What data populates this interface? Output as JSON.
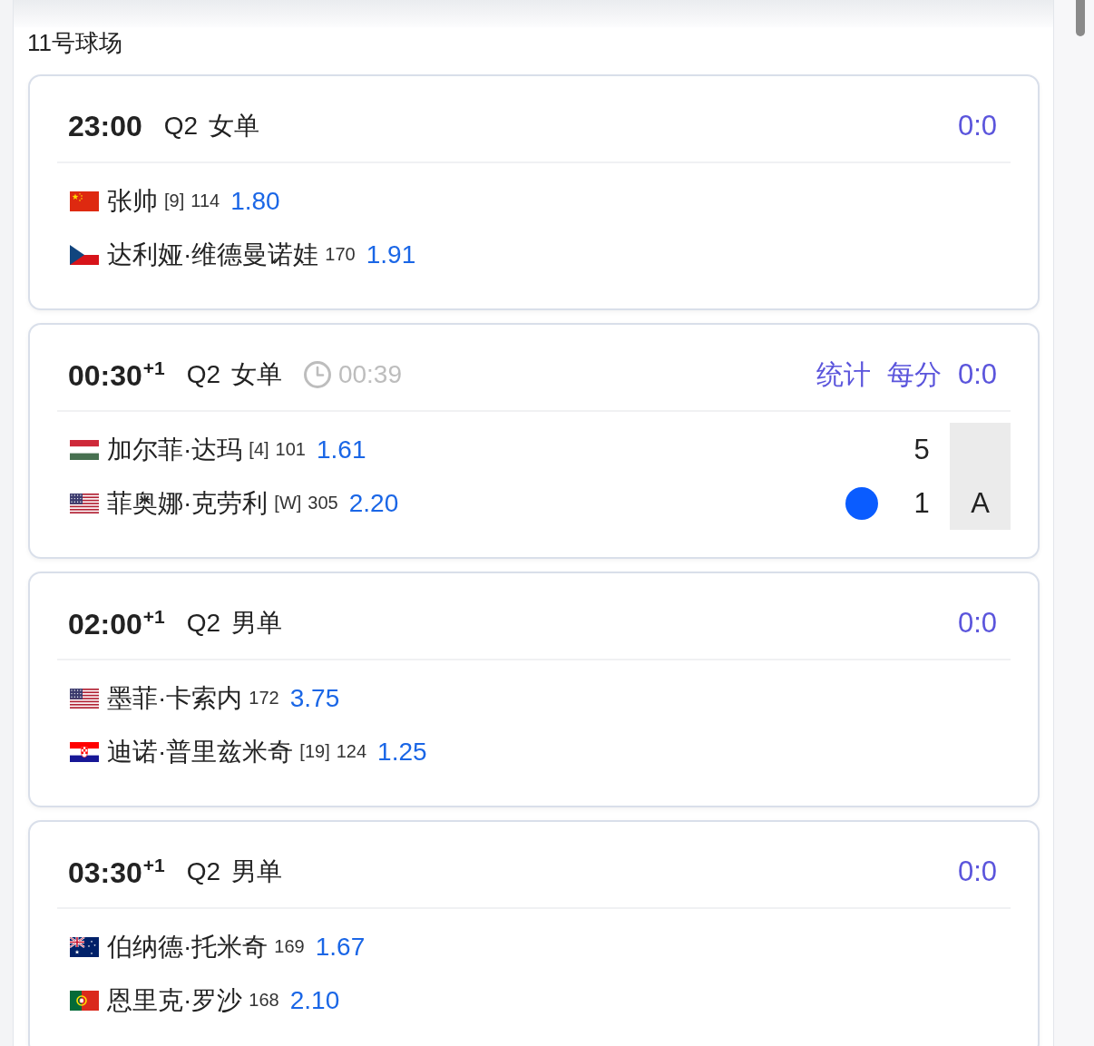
{
  "court": {
    "title": "11号球场"
  },
  "matches": [
    {
      "time": "23:00",
      "category": "Q2 女单",
      "score": "0:0",
      "players": [
        {
          "flag": {
            "kind": "cn"
          },
          "name": "张帅",
          "seed": "[9]",
          "ranking": "114",
          "odds": "1.80"
        },
        {
          "flag": {
            "kind": "cz"
          },
          "name": "达利娅·维德曼诺娃",
          "ranking": "170",
          "odds": "1.91"
        }
      ]
    },
    {
      "time": "00:30",
      "day_offset": "+1",
      "category": "Q2 女单",
      "elapsed": "00:39",
      "links": [
        "统计",
        "每分"
      ],
      "score": "0:0",
      "players": [
        {
          "flag": {
            "kind": "hu"
          },
          "name": "加尔菲·达玛",
          "seed": "[4]",
          "ranking": "101",
          "odds": "1.61",
          "serving": false,
          "games": "5"
        },
        {
          "flag": {
            "kind": "us"
          },
          "name": "菲奥娜·克劳利",
          "seed": "[W]",
          "ranking": "305",
          "odds": "2.20",
          "serving": true,
          "games": "1",
          "point": "A"
        }
      ]
    },
    {
      "time": "02:00",
      "day_offset": "+1",
      "category": "Q2 男单",
      "score": "0:0",
      "players": [
        {
          "flag": {
            "kind": "us"
          },
          "name": "墨菲·卡索内",
          "ranking": "172",
          "odds": "3.75"
        },
        {
          "flag": {
            "kind": "hr"
          },
          "name": "迪诺·普里兹米奇",
          "seed": "[19]",
          "ranking": "124",
          "odds": "1.25"
        }
      ]
    },
    {
      "time": "03:30",
      "day_offset": "+1",
      "category": "Q2 男单",
      "score": "0:0",
      "players": [
        {
          "flag": {
            "kind": "au"
          },
          "name": "伯纳德·托米奇",
          "ranking": "169",
          "odds": "1.67"
        },
        {
          "flag": {
            "kind": "pt"
          },
          "name": "恩里克·罗沙",
          "ranking": "168",
          "odds": "2.10"
        }
      ]
    }
  ]
}
